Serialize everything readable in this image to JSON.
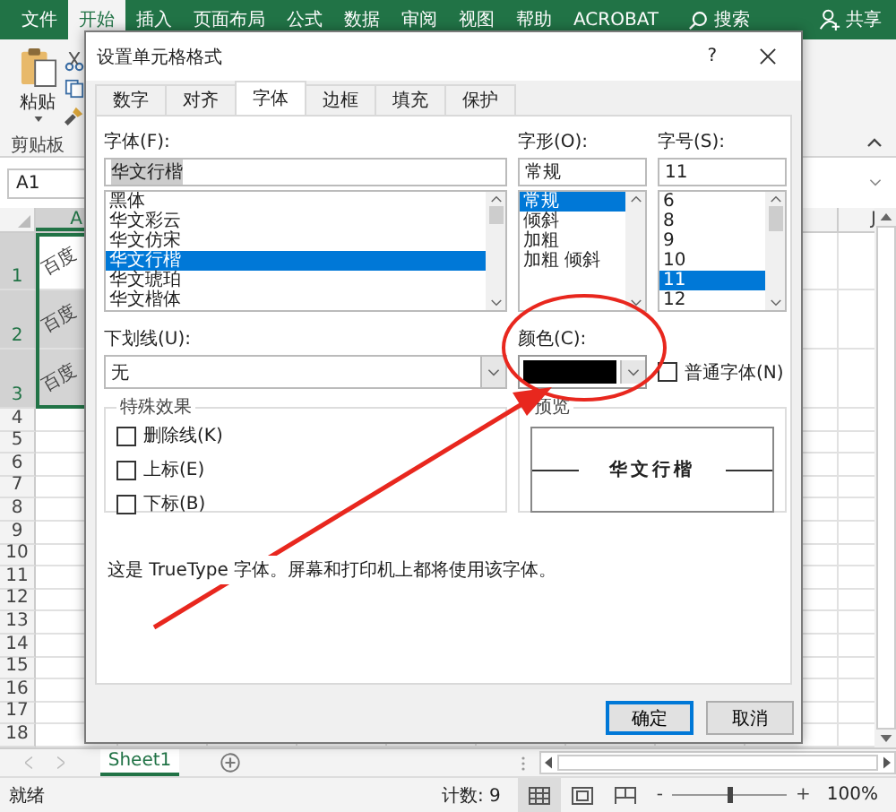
{
  "ribbon": {
    "tabs": [
      {
        "label": "文件",
        "selected": false
      },
      {
        "label": "开始",
        "selected": true
      },
      {
        "label": "插入",
        "selected": false
      },
      {
        "label": "页面布局",
        "selected": false
      },
      {
        "label": "公式",
        "selected": false
      },
      {
        "label": "数据",
        "selected": false
      },
      {
        "label": "审阅",
        "selected": false
      },
      {
        "label": "视图",
        "selected": false
      },
      {
        "label": "帮助",
        "selected": false
      },
      {
        "label": "ACROBAT",
        "selected": false
      }
    ],
    "search": "搜索",
    "share": "共享",
    "paste": "粘贴",
    "group_label": "剪贴板"
  },
  "name_box": "A1",
  "sheet": {
    "column_headers": [
      "A",
      "J"
    ],
    "row_headers": [
      "1",
      "2",
      "3",
      "4",
      "5",
      "6",
      "7",
      "8",
      "9",
      "10",
      "11",
      "12",
      "13",
      "14",
      "15",
      "16",
      "17",
      "18"
    ],
    "cells": [
      {
        "text": "百度",
        "active": true
      },
      {
        "text": "百度",
        "active": false
      },
      {
        "text": "百度",
        "active": false
      }
    ]
  },
  "sheet_tabs": [
    {
      "label": "Sheet1",
      "selected": true
    }
  ],
  "status_bar": {
    "status": "就绪",
    "count": "计数: 9",
    "views": [
      {
        "kind": "normal",
        "selected": true
      },
      {
        "kind": "page-layout",
        "selected": false
      },
      {
        "kind": "page-break",
        "selected": false
      }
    ],
    "zoom": {
      "minus": "-",
      "plus": "+",
      "level": 0.5,
      "reading": "100%"
    }
  },
  "dialog": {
    "title": "设置单元格格式",
    "help": "?",
    "tabs": [
      {
        "label": "数字",
        "selected": false
      },
      {
        "label": "对齐",
        "selected": false
      },
      {
        "label": "字体",
        "selected": true
      },
      {
        "label": "边框",
        "selected": false
      },
      {
        "label": "填充",
        "selected": false
      },
      {
        "label": "保护",
        "selected": false
      }
    ],
    "font": {
      "label": "字体(F):",
      "value": "华文行楷",
      "items": [
        {
          "label": "黑体",
          "selected": false
        },
        {
          "label": "华文彩云",
          "selected": false
        },
        {
          "label": "华文仿宋",
          "selected": false
        },
        {
          "label": "华文行楷",
          "selected": true
        },
        {
          "label": "华文琥珀",
          "selected": false
        },
        {
          "label": "华文楷体",
          "selected": false
        }
      ]
    },
    "style": {
      "label": "字形(O):",
      "value": "常规",
      "items": [
        {
          "label": "常规",
          "selected": true
        },
        {
          "label": "倾斜",
          "selected": false
        },
        {
          "label": "加粗",
          "selected": false
        },
        {
          "label": "加粗 倾斜",
          "selected": false
        }
      ]
    },
    "size": {
      "label": "字号(S):",
      "value": "11",
      "items": [
        {
          "label": "6",
          "selected": false
        },
        {
          "label": "8",
          "selected": false
        },
        {
          "label": "9",
          "selected": false
        },
        {
          "label": "10",
          "selected": false
        },
        {
          "label": "11",
          "selected": true
        },
        {
          "label": "12",
          "selected": false
        }
      ]
    },
    "underline": {
      "label": "下划线(U):",
      "value": "无"
    },
    "color": {
      "label": "颜色(C):"
    },
    "normal_font": {
      "label": "普通字体(N)",
      "checked": false
    },
    "effects": {
      "title": "特殊效果",
      "items": [
        {
          "label": "删除线(K)",
          "checked": false
        },
        {
          "label": "上标(E)",
          "checked": false
        },
        {
          "label": "下标(B)",
          "checked": false
        }
      ]
    },
    "preview": {
      "title": "预览",
      "sample": "华文行楷"
    },
    "note": "这是 TrueType 字体。屏幕和打印机上都将使用该字体。",
    "buttons": [
      {
        "label": "确定",
        "default": true
      },
      {
        "label": "取消",
        "default": false
      }
    ]
  }
}
